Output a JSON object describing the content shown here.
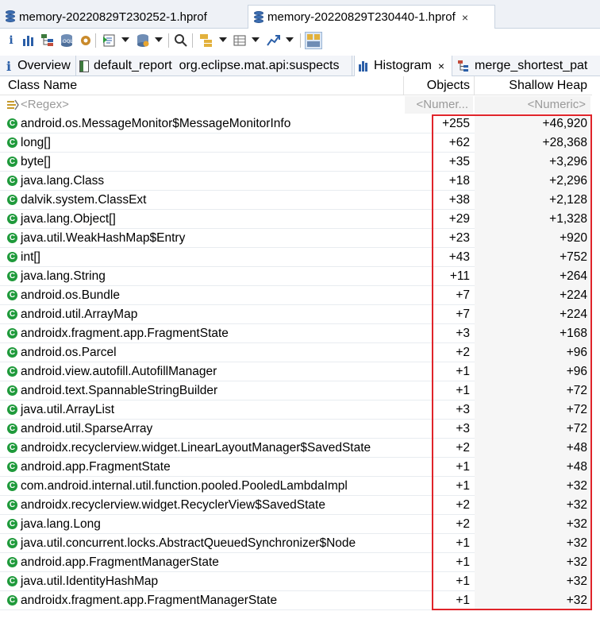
{
  "editor_tabs": [
    {
      "label": "memory-20220829T230252-1.hprof",
      "active": false
    },
    {
      "label": "memory-20220829T230440-1.hprof",
      "active": true,
      "close": "×"
    }
  ],
  "toolbar_icons": [
    "info-icon",
    "histogram-icon",
    "dominator-tree-icon",
    "oql-icon",
    "heap-dump-overview-icon",
    "run-report-icon",
    "query-browser-icon",
    "search-icon",
    "group-by-icon",
    "calculate-retained-icon",
    "export-icon",
    "compare-icon"
  ],
  "view_tabs": [
    {
      "label": "Overview",
      "prefix": "i"
    },
    {
      "label": "default_report  org.eclipse.mat.api:suspects"
    },
    {
      "label": "Histogram",
      "close": "×",
      "active": true
    },
    {
      "label": "merge_shortest_pat"
    }
  ],
  "table": {
    "headers": {
      "class_name": "Class Name",
      "objects": "Objects",
      "shallow_heap": "Shallow Heap"
    },
    "filter": {
      "class_name": "<Regex>",
      "objects": "<Numer...",
      "shallow_heap": "<Numeric>"
    },
    "rows": [
      {
        "name": "android.os.MessageMonitor$MessageMonitorInfo",
        "objects": "+255",
        "heap": "+46,920"
      },
      {
        "name": "long[]",
        "objects": "+62",
        "heap": "+28,368"
      },
      {
        "name": "byte[]",
        "objects": "+35",
        "heap": "+3,296"
      },
      {
        "name": "java.lang.Class",
        "objects": "+18",
        "heap": "+2,296"
      },
      {
        "name": "dalvik.system.ClassExt",
        "objects": "+38",
        "heap": "+2,128"
      },
      {
        "name": "java.lang.Object[]",
        "objects": "+29",
        "heap": "+1,328"
      },
      {
        "name": "java.util.WeakHashMap$Entry",
        "objects": "+23",
        "heap": "+920"
      },
      {
        "name": "int[]",
        "objects": "+43",
        "heap": "+752"
      },
      {
        "name": "java.lang.String",
        "objects": "+11",
        "heap": "+264"
      },
      {
        "name": "android.os.Bundle",
        "objects": "+7",
        "heap": "+224"
      },
      {
        "name": "android.util.ArrayMap",
        "objects": "+7",
        "heap": "+224"
      },
      {
        "name": "androidx.fragment.app.FragmentState",
        "objects": "+3",
        "heap": "+168"
      },
      {
        "name": "android.os.Parcel",
        "objects": "+2",
        "heap": "+96"
      },
      {
        "name": "android.view.autofill.AutofillManager",
        "objects": "+1",
        "heap": "+96"
      },
      {
        "name": "android.text.SpannableStringBuilder",
        "objects": "+1",
        "heap": "+72"
      },
      {
        "name": "java.util.ArrayList",
        "objects": "+3",
        "heap": "+72"
      },
      {
        "name": "android.util.SparseArray",
        "objects": "+3",
        "heap": "+72"
      },
      {
        "name": "androidx.recyclerview.widget.LinearLayoutManager$SavedState",
        "objects": "+2",
        "heap": "+48"
      },
      {
        "name": "android.app.FragmentState",
        "objects": "+1",
        "heap": "+48"
      },
      {
        "name": "com.android.internal.util.function.pooled.PooledLambdaImpl",
        "objects": "+1",
        "heap": "+32"
      },
      {
        "name": "androidx.recyclerview.widget.RecyclerView$SavedState",
        "objects": "+2",
        "heap": "+32"
      },
      {
        "name": "java.lang.Long",
        "objects": "+2",
        "heap": "+32"
      },
      {
        "name": "java.util.concurrent.locks.AbstractQueuedSynchronizer$Node",
        "objects": "+1",
        "heap": "+32"
      },
      {
        "name": "android.app.FragmentManagerState",
        "objects": "+1",
        "heap": "+32"
      },
      {
        "name": "java.util.IdentityHashMap",
        "objects": "+1",
        "heap": "+32"
      },
      {
        "name": "androidx.fragment.app.FragmentManagerState",
        "objects": "+1",
        "heap": "+32"
      }
    ]
  },
  "colors": {
    "class_icon": "#1f9a3b",
    "highlight": "#e0242a",
    "db_icon": "#3d6fb4"
  }
}
